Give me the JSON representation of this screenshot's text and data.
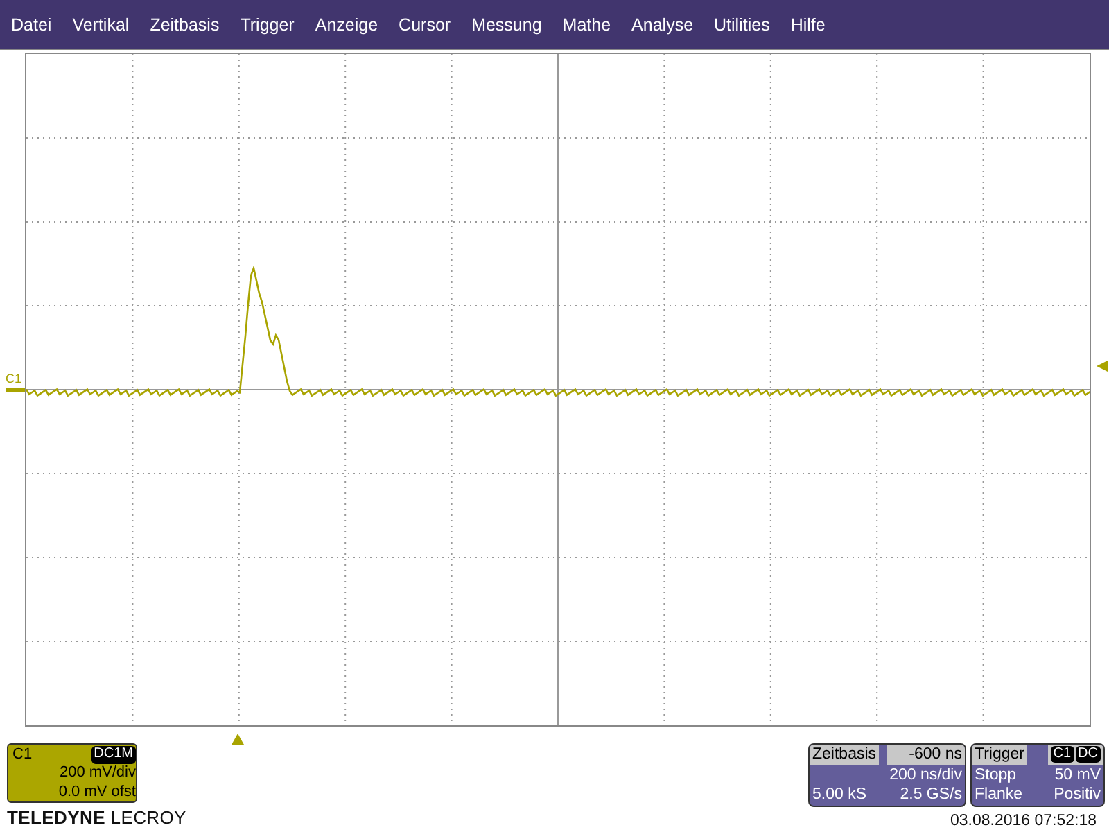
{
  "menu": [
    "Datei",
    "Vertikal",
    "Zeitbasis",
    "Trigger",
    "Anzeige",
    "Cursor",
    "Messung",
    "Mathe",
    "Analyse",
    "Utilities",
    "Hilfe"
  ],
  "plot": {
    "trace_label": "C1"
  },
  "channel": {
    "name": "C1",
    "coupling": "DC1M",
    "scale": "200 mV/div",
    "offset": "0.0 mV ofst"
  },
  "logo": "**TELEDYNE** LECROY",
  "timebase": {
    "title": "Zeitbasis",
    "delay": "-600 ns",
    "scale": "200 ns/div",
    "samples": "5.00 kS",
    "rate": "2.5 GS/s"
  },
  "trigger": {
    "title": "Trigger",
    "source": "C1",
    "coupling": "DC",
    "mode": "Stopp",
    "level": "50 mV",
    "type": "Flanke",
    "slope": "Positiv"
  },
  "timestamp": "03.08.2016 07:52:18"
}
